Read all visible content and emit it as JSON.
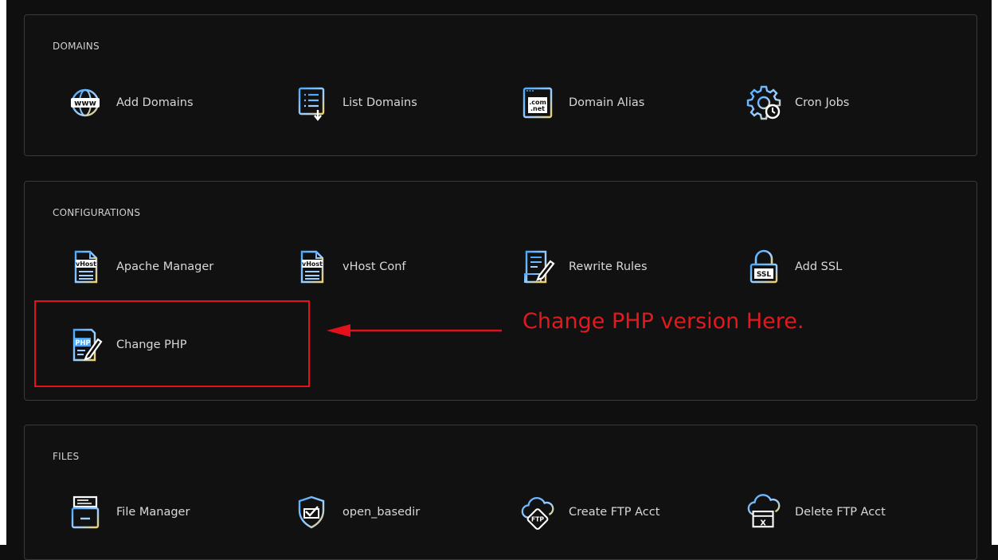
{
  "sections": {
    "domains": {
      "title": "DOMAINS",
      "items": [
        "Add Domains",
        "List Domains",
        "Domain Alias",
        "Cron Jobs"
      ]
    },
    "configurations": {
      "title": "CONFIGURATIONS",
      "items": [
        "Apache Manager",
        "vHost Conf",
        "Rewrite Rules",
        "Add SSL",
        "Change PHP"
      ]
    },
    "files": {
      "title": "FILES",
      "items": [
        "File Manager",
        "open_basedir",
        "Create FTP Acct",
        "Delete FTP Acct"
      ]
    }
  },
  "icon_text": {
    "www": "www",
    "com": ".com",
    "net": ".net",
    "vhost": "vHost",
    "ssl": "SSL",
    "php": "PHP",
    "ftp": "FTP",
    "x": "X"
  },
  "annotation": {
    "text": "Change PHP version Here."
  },
  "colors": {
    "icon_gradient_start": "#4aa8ff",
    "icon_gradient_end": "#f2d16b",
    "highlight_red": "#e2111b"
  }
}
